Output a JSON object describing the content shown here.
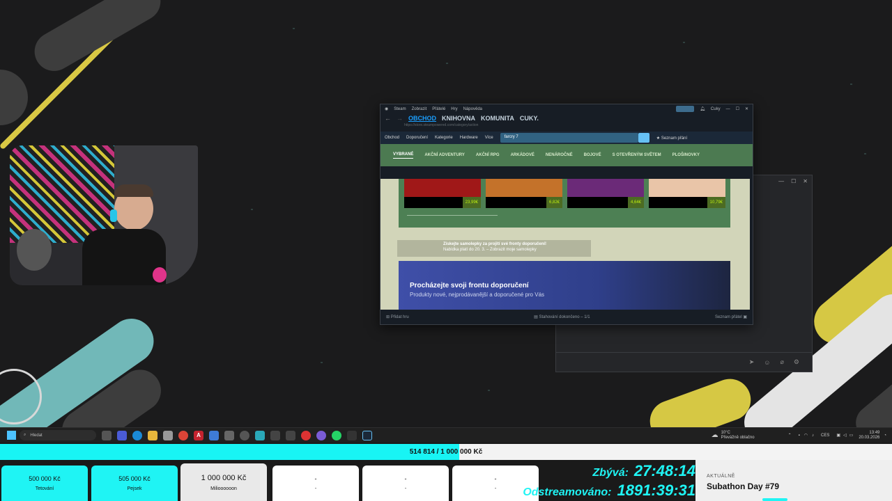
{
  "steam": {
    "titlebar": {
      "app": "Steam",
      "menu": [
        "Zobrazit",
        "Přátelé",
        "Hry",
        "Nápověda"
      ],
      "user": "Cuky"
    },
    "nav": [
      "OBCHOD",
      "KNIHOVNA",
      "KOMUNITA",
      "CUKY."
    ],
    "url": "https://store.steampowered.com/category/action",
    "storebar": [
      "Obchod",
      "Doporučení",
      "Kategorie",
      "Hardware",
      "Více"
    ],
    "search_value": "farcry 7",
    "wishlist": "Seznam přání",
    "tabs": [
      "VYBRANÉ",
      "AKČNÍ ADVENTURY",
      "AKČNÍ RPG",
      "ARKÁDOVÉ",
      "NENÁROČNÉ",
      "BOJOVÉ",
      "S OTEVŘENÝM SVĚTEM",
      "PLOŠINOVKY"
    ],
    "games": [
      {
        "price": "23,99€",
        "color": "#a01818"
      },
      {
        "price": "6,82€",
        "color": "#c4722a"
      },
      {
        "price": "4,64€",
        "color": "#6b2a78"
      },
      {
        "price": "10,79€",
        "color": "#e9c5a8"
      }
    ],
    "sticker_title": "Získejte samolepky za projití své fronty doporučení!",
    "sticker_sub": "Nabídka platí do 20. 3. – Zobrazit moje samolepky",
    "banner_title": "Procházejte svoji frontu doporučení",
    "banner_sub": "Produkty nové, nejprodávanější a doporučené pro Vás",
    "footer_add": "Přidat hru",
    "footer_dl": "Stahování dokončeno – 1/1",
    "footer_friends": "Seznam přátel"
  },
  "taskbar": {
    "search": "Hledat",
    "weather_temp": "10°C",
    "weather_desc": "Převážně oblačno",
    "lang": "CES",
    "time": "13:49",
    "date": "20.03.2026"
  },
  "progress": {
    "text": "514 814 / 1 000 000 Kč",
    "fraction": 0.514814
  },
  "goals": [
    {
      "value": "500 000 Kč",
      "label": "Tetování",
      "state": "done"
    },
    {
      "value": "505 000 Kč",
      "label": "Pejsek",
      "state": "done"
    },
    {
      "value": "1 000 000 Kč",
      "label": "Milioooooon",
      "state": "current"
    },
    {
      "value": "-",
      "label": "-",
      "state": "empty"
    },
    {
      "value": "-",
      "label": "-",
      "state": "empty"
    },
    {
      "value": "-",
      "label": "-",
      "state": "empty"
    }
  ],
  "timers": {
    "remaining_label": "Zbývá:",
    "remaining": "27:48:14",
    "streamed_label": "Odstreamováno:",
    "streamed": "1891:39:31"
  },
  "now": {
    "kicker": "AKTUÁLNĚ",
    "title": "Subathon Day #79"
  },
  "colors": {
    "accent": "#1ff4f4",
    "steam_green": "#4c7a51",
    "steam_blue": "#1a9fff"
  }
}
